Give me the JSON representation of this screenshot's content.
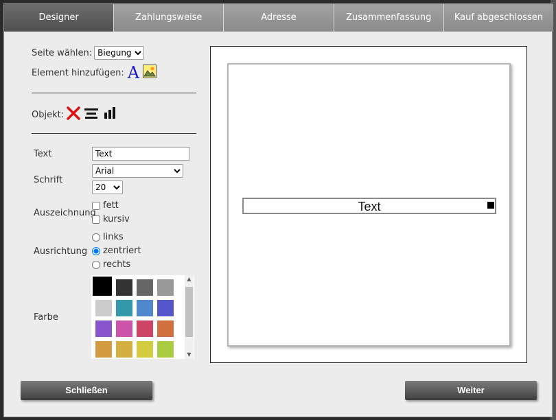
{
  "tabs": [
    {
      "label": "Designer",
      "active": true
    },
    {
      "label": "Zahlungsweise",
      "active": false
    },
    {
      "label": "Adresse",
      "active": false
    },
    {
      "label": "Zusammenfassung",
      "active": false
    },
    {
      "label": "Kauf abgeschlossen",
      "active": false
    }
  ],
  "left": {
    "page_select_label": "Seite wählen:",
    "page_select_value": "Biegung",
    "add_element_label": "Element hinzufügen:",
    "add_text_icon": "A",
    "object_label": "Objekt:"
  },
  "props": {
    "text_label": "Text",
    "text_value": "Text",
    "font_label": "Schrift",
    "font_value": "Arial",
    "size_value": "20",
    "style_label": "Auszeichnung",
    "bold_label": "fett",
    "italic_label": "kursiv",
    "align_label": "Ausrichtung",
    "align_left": "links",
    "align_center": "zentriert",
    "align_right": "rechts",
    "color_label": "Farbe"
  },
  "palette": {
    "selected": "#000000",
    "colors": [
      "#000000",
      "#333333",
      "#666666",
      "#999999",
      "#cccccc",
      "#3399aa",
      "#4f88cc",
      "#5555cc",
      "#8855cc",
      "#cc55aa",
      "#cc4466",
      "#d07040",
      "#d49a40",
      "#d4b040",
      "#d4cc40",
      "#aacc40"
    ]
  },
  "canvas": {
    "element_text": "Text"
  },
  "footer": {
    "close_label": "Schließen",
    "next_label": "Weiter"
  }
}
